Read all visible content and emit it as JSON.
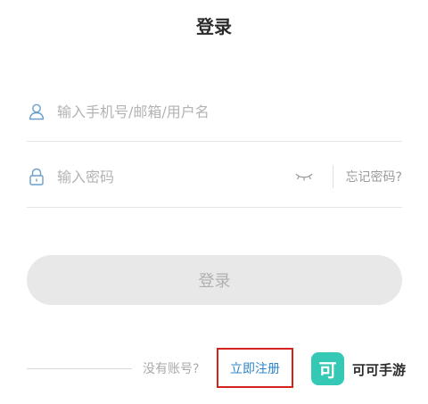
{
  "header": {
    "title": "登录"
  },
  "form": {
    "username": {
      "placeholder": "输入手机号/邮箱/用户名",
      "value": "",
      "icon": "user-icon"
    },
    "password": {
      "placeholder": "输入密码",
      "value": "",
      "icon": "lock-icon",
      "toggle_icon": "eye-closed-icon"
    },
    "forgot_label": "忘记密码?",
    "submit_label": "登录"
  },
  "footer": {
    "no_account_text": "没有账号?",
    "register_label": "立即注册"
  },
  "brand": {
    "logo_char": "可",
    "name": "可可手游",
    "color": "#35c9b5"
  },
  "colors": {
    "accent_link": "#2d84c8",
    "highlight_box": "#d4221c",
    "icon": "#6b9ecb"
  }
}
